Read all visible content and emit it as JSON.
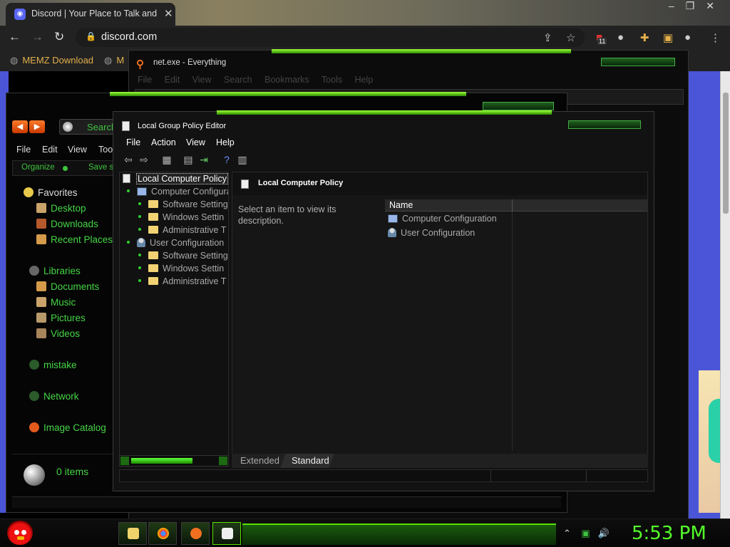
{
  "browser": {
    "tab_title": "Discord | Your Place to Talk and H",
    "url": "discord.com",
    "bookmarks": [
      "MEMZ Download",
      "M"
    ],
    "extension_badge": "11",
    "window_controls_icons": [
      "minimize-icon",
      "maximize-icon",
      "close-icon"
    ]
  },
  "everything_window": {
    "title": "net.exe - Everything",
    "menu": [
      "File",
      "Edit",
      "View",
      "Search",
      "Bookmarks",
      "Tools",
      "Help"
    ]
  },
  "explorer_window": {
    "search_placeholder": "Search",
    "menu": [
      "File",
      "Edit",
      "View",
      "Too"
    ],
    "organize_label": "Organize",
    "save_label": "Save se",
    "nav": {
      "favorites": "Favorites",
      "favorite_items": [
        "Desktop",
        "Downloads",
        "Recent Places"
      ],
      "libraries": "Libraries",
      "library_items": [
        "Documents",
        "Music",
        "Pictures",
        "Videos"
      ],
      "mistake": "mistake",
      "network": "Network",
      "image_catalog": "Image Catalog"
    },
    "item_count": "0 items"
  },
  "gpedit_window": {
    "title": "Local Group Policy Editor",
    "menu": [
      "File",
      "Action",
      "View",
      "Help"
    ],
    "tree": {
      "root": "Local Computer Policy",
      "computer_config": "Computer Configura",
      "user_config": "User Configuration",
      "software_settings": "Software Setting",
      "windows_settings": "Windows Settin",
      "admin_templates": "Administrative T"
    },
    "right_header": "Local Computer Policy",
    "description": "Select an item to view its description.",
    "list_header": "Name",
    "list_items": [
      "Computer Configuration",
      "User Configuration"
    ],
    "tabs": [
      "Extended",
      "Standard"
    ],
    "active_tab": "Standard"
  },
  "taskbar": {
    "clock": "5:53 PM",
    "accent_color": "#54ff2a"
  }
}
